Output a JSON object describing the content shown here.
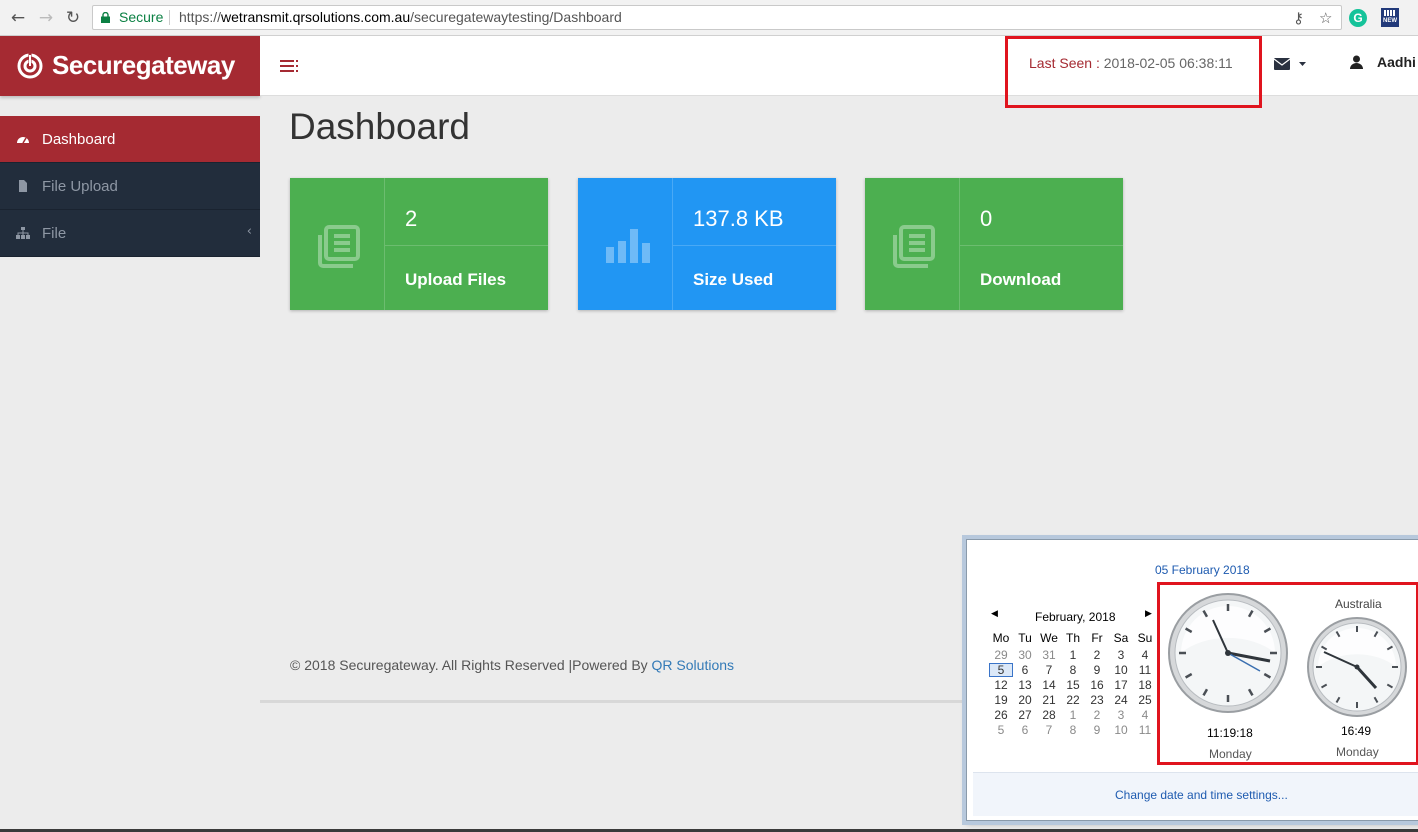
{
  "browser": {
    "secure_label": "Secure",
    "url_scheme": "https://",
    "url_host": "wetransmit.qrsolutions.com.au",
    "url_path": "/securegatewaytesting/Dashboard",
    "ext_g": "G",
    "ext_new": "NEW"
  },
  "brand": {
    "name": "Securegateway",
    "color": "#a52a32"
  },
  "sidebar": {
    "items": [
      {
        "label": "Dashboard",
        "icon": "dashboard-icon"
      },
      {
        "label": "File Upload",
        "icon": "file-icon"
      },
      {
        "label": "File",
        "icon": "sitemap-icon"
      }
    ]
  },
  "header": {
    "last_seen_label": "Last Seen : ",
    "last_seen_value": "2018-02-05 06:38:11",
    "user_name": "Aadhi"
  },
  "page": {
    "title": "Dashboard"
  },
  "cards": [
    {
      "value": "2",
      "label": "Upload Files",
      "color": "#4caf50",
      "icon": "newspaper-icon"
    },
    {
      "value": "137.8 KB",
      "label": "Size Used",
      "color": "#2196f3",
      "icon": "bar-chart-icon"
    },
    {
      "value": "0",
      "label": "Download",
      "color": "#4caf50",
      "icon": "newspaper-icon"
    }
  ],
  "footer": {
    "text": "© 2018 Securegateway. All Rights Reserved |Powered By ",
    "link": "QR Solutions"
  },
  "clock_popup": {
    "date_long": "05 February 2018",
    "calendar": {
      "title": "February, 2018",
      "weekdays": [
        "Mo",
        "Tu",
        "We",
        "Th",
        "Fr",
        "Sa",
        "Su"
      ],
      "weeks": [
        [
          "29",
          "30",
          "31",
          "1",
          "2",
          "3",
          "4"
        ],
        [
          "5",
          "6",
          "7",
          "8",
          "9",
          "10",
          "11"
        ],
        [
          "12",
          "13",
          "14",
          "15",
          "16",
          "17",
          "18"
        ],
        [
          "19",
          "20",
          "21",
          "22",
          "23",
          "24",
          "25"
        ],
        [
          "26",
          "27",
          "28",
          "1",
          "2",
          "3",
          "4"
        ],
        [
          "5",
          "6",
          "7",
          "8",
          "9",
          "10",
          "11"
        ]
      ],
      "today": "5"
    },
    "local_clock": {
      "time": "11:19:18",
      "day": "Monday"
    },
    "second_clock": {
      "label": "Australia",
      "time": "16:49",
      "day": "Monday"
    },
    "settings_link": "Change date and time settings..."
  }
}
